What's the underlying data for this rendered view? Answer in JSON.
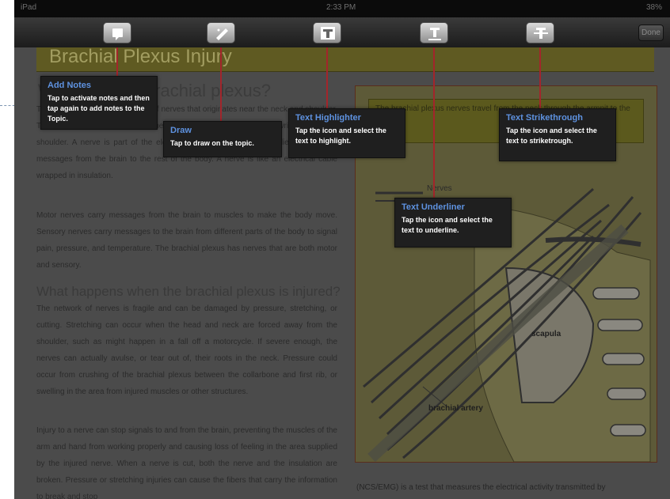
{
  "status_bar": {
    "carrier": "iPad",
    "time": "2:33 PM",
    "battery": "38%"
  },
  "toolbar": {
    "buttons": [
      {
        "name": "add-notes",
        "icon": "note-icon"
      },
      {
        "name": "draw",
        "icon": "pencil-icon"
      },
      {
        "name": "text-highlighter",
        "icon": "text-highlight-icon"
      },
      {
        "name": "text-underliner",
        "icon": "text-underline-icon"
      },
      {
        "name": "text-strikethrough",
        "icon": "text-strikethrough-icon"
      }
    ],
    "done_label": "Done"
  },
  "document": {
    "title": "Brachial Plexus Injury",
    "heading1_fragment": "W",
    "heading1_tail": "brachial plexus?",
    "para1": "The brachial plexus is a network of nerves that originates near the neck and shoulder. These nerves send signals from the spinal cord to control the hand, wrist, elbow, and shoulder. A nerve is part of the electrical wiring system in our bodies that carries messages from the brain to the rest of the body. A nerve is like an electrical cable wrapped in insulation.",
    "para2": "Motor nerves carry messages from the brain to muscles to make the body move. Sensory nerves carry messages to the brain from different parts of the body to signal pain, pressure, and temperature. The brachial plexus has nerves that are both motor and sensory.",
    "heading2": "What happens when the brachial plexus is injured?",
    "para3": "The network of nerves is fragile and can be damaged by pressure, stretching, or cutting. Stretching can occur when the head and neck are forced away from the shoulder, such as might happen in a fall off a motorcycle. If severe enough, the nerves can actually avulse, or tear out of, their roots in the neck. Pressure could occur from crushing of the brachial plexus between the collarbone and first rib, or swelling in the area from injured muscles or other structures.",
    "para4": "Injury to a nerve can stop signals to and from the brain, preventing the muscles of the arm and hand from working properly and causing loss of feeling in the area supplied by the injured nerve. When a nerve is cut, both the nerve and the insulation are broken. Pressure or stretching injuries can cause the fibers that carry the information to break and stop",
    "figure_note": "The brachial plexus nerves travel from the neck through the armpit to the arm.",
    "figure_labels": {
      "nerves": "Nerves",
      "scapula": "scapula",
      "artery": "brachial artery"
    },
    "caption": "(NCS/EMG) is a test that measures the electrical activity transmitted by"
  },
  "callouts": {
    "add_notes": {
      "title": "Add Notes",
      "desc": "Tap to activate notes and then tap again to add notes to the Topic."
    },
    "draw": {
      "title": "Draw",
      "desc": "Tap to draw on the topic."
    },
    "text_highlighter": {
      "title": "Text Highlighter",
      "desc": "Tap the icon and select the text to highlight."
    },
    "text_underliner": {
      "title": "Text Underliner",
      "desc": "Tap the icon and select the text to underline."
    },
    "text_strikethrough": {
      "title": "Text Strikethrough",
      "desc": "Tap the icon and select the text to striketrough."
    }
  },
  "colors": {
    "callout_title": "#5e92e0",
    "leader_line": "#a3252b",
    "title_bar": "#5f5a22"
  }
}
